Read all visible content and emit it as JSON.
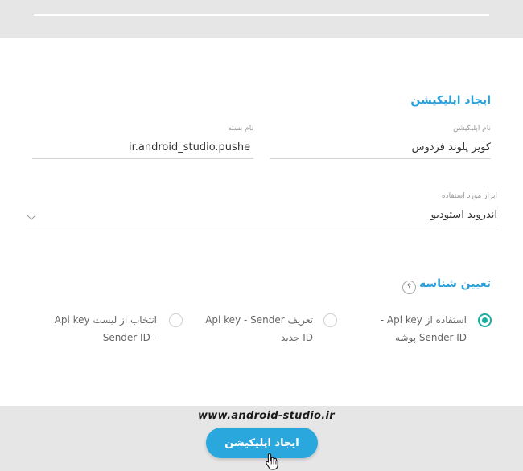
{
  "form": {
    "title": "ایجاد اپلیکیشن",
    "app_name": {
      "label": "نام اپلیکیشن",
      "value": "کویر پلوند فردوس"
    },
    "package_name": {
      "label": "نام بسته",
      "value": "ir.android_studio.pushe"
    },
    "tool": {
      "label": "ابزار مورد استفاده",
      "value": "اندروید استودیو"
    }
  },
  "identity": {
    "title": "تعیین شناسه",
    "help_symbol": "؟",
    "options": [
      {
        "line1": "استفاده از Api key -",
        "line2": "Sender ID پوشه",
        "checked": true
      },
      {
        "line1": "تعریف Api key - Sender",
        "line2": "ID جدید",
        "checked": false
      },
      {
        "line1": "انتخاب از لیست Api key",
        "line2": "- Sender ID",
        "checked": false
      }
    ]
  },
  "footer": {
    "watermark": "www.android-studio.ir",
    "create_label": "ایجاد اپلیکیشن"
  },
  "colors": {
    "accent": "#2aa0d8",
    "radio": "#17b0a0",
    "band": "#e6e6e6"
  }
}
